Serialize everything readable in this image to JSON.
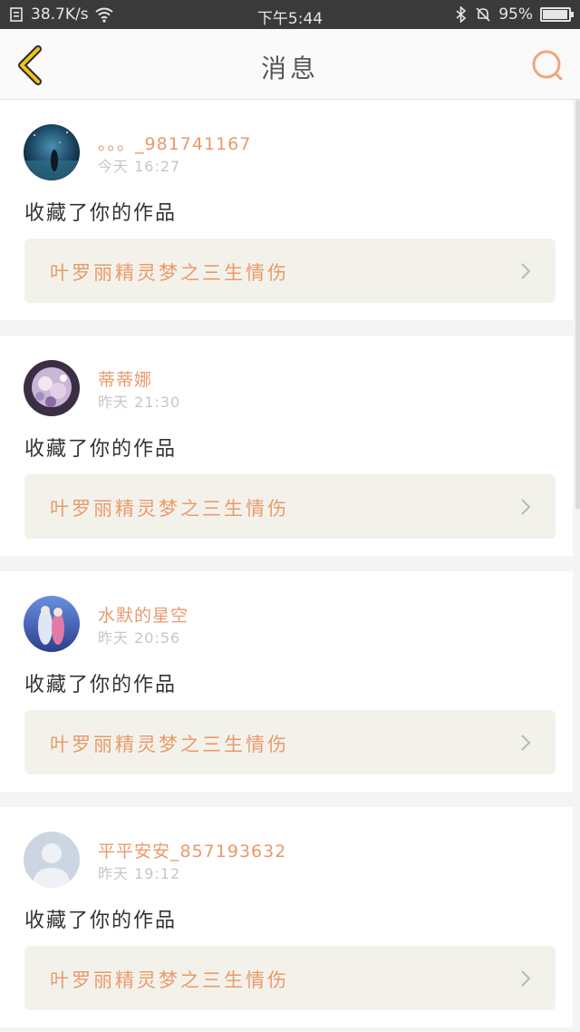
{
  "status_bar": {
    "network_speed": "38.7K/s",
    "time": "下午5:44",
    "battery_percent": "95%",
    "battery_level": 0.95
  },
  "header": {
    "title": "消息"
  },
  "colors": {
    "accent": "#e99a6c",
    "back_icon": "#f3c21c"
  },
  "messages": [
    {
      "username": "。。。_981741167",
      "time": "今天 16:27",
      "action": "收藏了你的作品",
      "work_title": "叶罗丽精灵梦之三生情伤"
    },
    {
      "username": "蒂蒂娜",
      "time": "昨天 21:30",
      "action": "收藏了你的作品",
      "work_title": "叶罗丽精灵梦之三生情伤"
    },
    {
      "username": "水默的星空",
      "time": "昨天 20:56",
      "action": "收藏了你的作品",
      "work_title": "叶罗丽精灵梦之三生情伤"
    },
    {
      "username": "平平安安_857193632",
      "time": "昨天 19:12",
      "action": "收藏了你的作品",
      "work_title": "叶罗丽精灵梦之三生情伤"
    }
  ]
}
